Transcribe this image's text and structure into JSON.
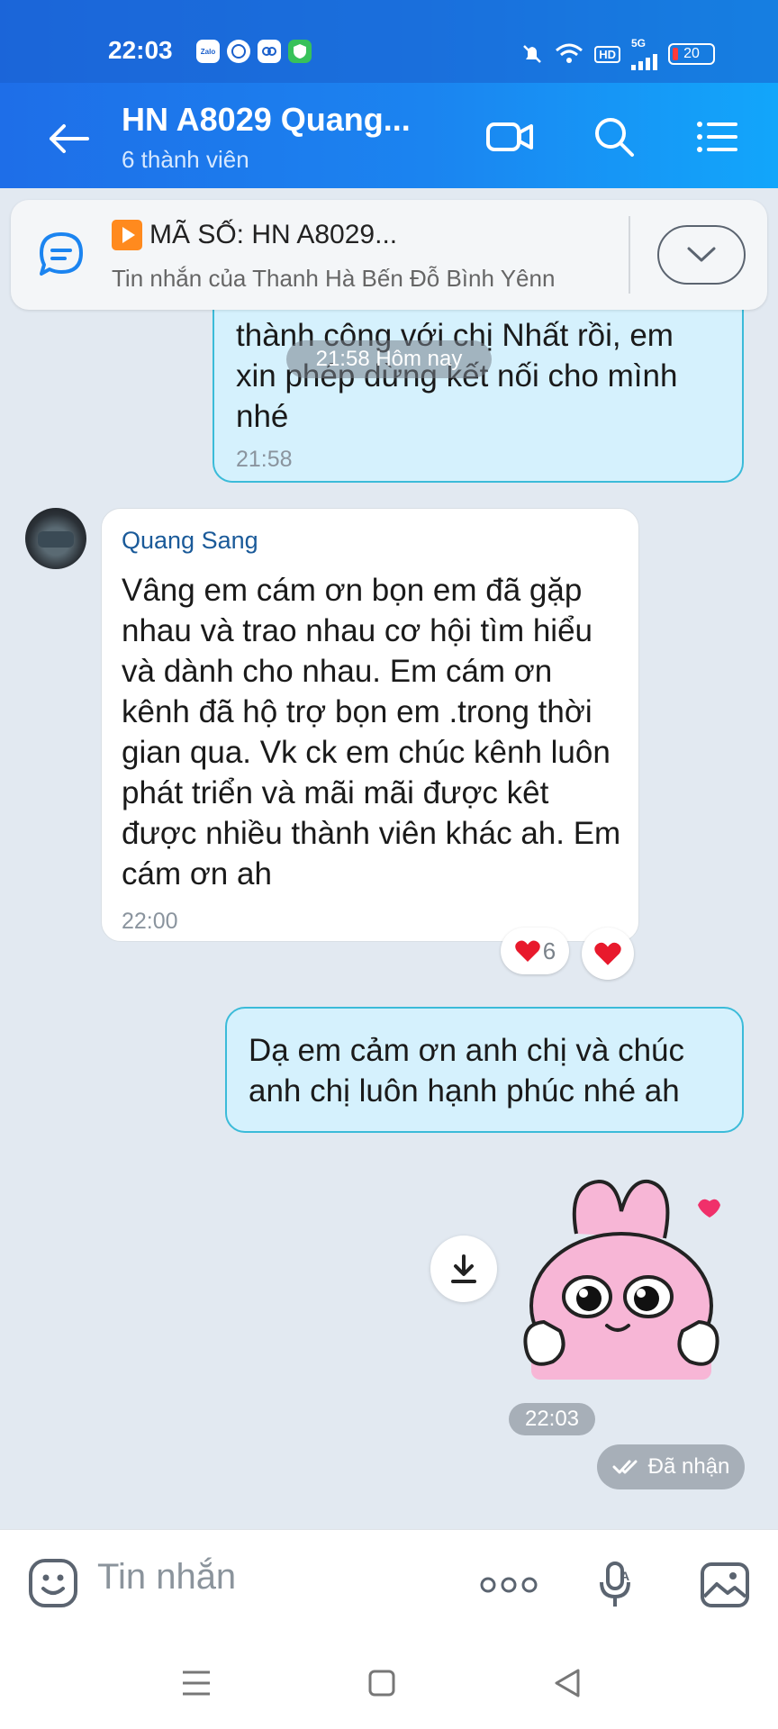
{
  "status_bar": {
    "time": "22:03",
    "apps": [
      "Zalo",
      "WhatsApp",
      "app-icon",
      "shield-icon"
    ],
    "network": "5G",
    "hd": "HD",
    "battery": "20"
  },
  "header": {
    "title": "HN A8029 Quang...",
    "subtitle": "6 thành viên"
  },
  "pinned": {
    "title": "MÃ SỐ: HN A8029...",
    "subtitle": "Tin nhắn của Thanh Hà Bến Đỗ Bình Yênn"
  },
  "messages": {
    "m1": {
      "lines": [
        "thành công với chị Nhất rồi, em",
        "xin phép dừng kết nối cho mình",
        "nhé"
      ],
      "time": "21:58"
    },
    "date_chip": "21:58 Hôm nay",
    "m2": {
      "sender": "Quang Sang",
      "text": "Vâng em cám ơn bọn em đã gặp nhau và trao nhau cơ hội tìm hiểu và dành cho nhau. Em cám ơn kênh đã hộ trợ bọn em .trong thời gian qua. Vk ck em chúc kênh luôn phát triển và mãi mãi được kêt được nhiều thành viên khác ah. Em cám ơn ah",
      "time": "22:00",
      "reactions": {
        "heart_count": "6"
      }
    },
    "m3": {
      "text": "Dạ em cảm ơn anh chị và chúc anh chị luôn hạnh phúc nhé ah"
    },
    "sticker_time": "22:03",
    "delivery_status": "Đã nhận"
  },
  "input_bar": {
    "placeholder": "Tin nhắn"
  },
  "colors": {
    "header_start": "#1e6ee8",
    "header_end": "#12a6fb",
    "my_bubble": "#d5f1fd",
    "my_bubble_border": "#3bbbd9",
    "chat_bg": "#e2e9f1"
  }
}
